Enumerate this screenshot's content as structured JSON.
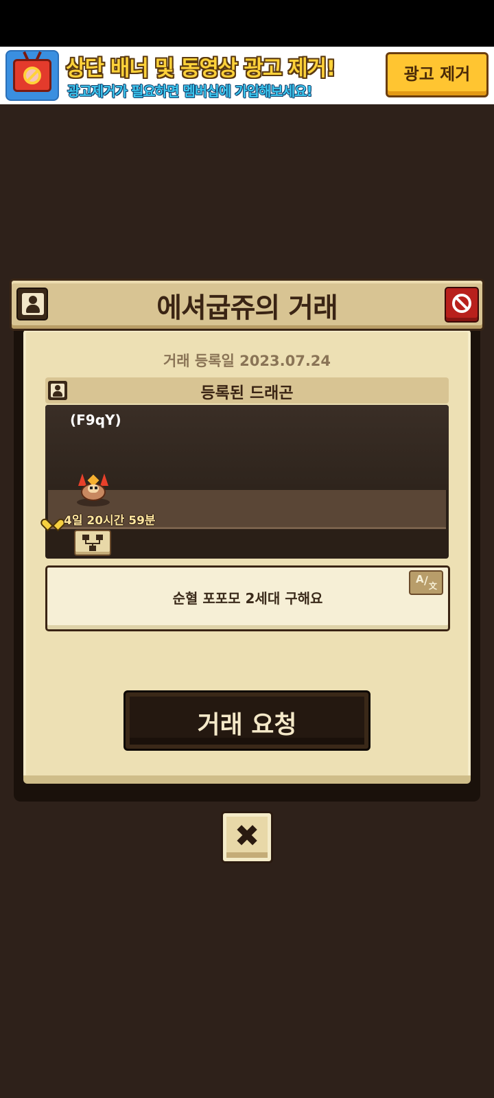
{
  "ad_banner": {
    "title": "상단 배너 및 동영상 광고 제거!",
    "subtitle": "광고제거가 필요하면 멤버십에 가입해보세요!",
    "remove_button": "광고 제거",
    "icon": "no-ads-tv-icon"
  },
  "trade_panel": {
    "title": "에셔굽쥬의 거래",
    "profile_icon": "profile-icon",
    "block_icon": "block-icon",
    "registered_date": "거래 등록일 2023.07.24",
    "section_title": "등록된 드래곤",
    "dragon": {
      "name": "(F9qY)",
      "timer": "4일 20시간 59분",
      "timer_icon": "heart-icon",
      "family_tree_icon": "family-tree-icon"
    },
    "memo": "순혈 포포모 2세대 구해요",
    "translate_icon": "translate-icon",
    "translate_label": {
      "a": "A",
      "slash": "/",
      "z": "文"
    },
    "request_button": "거래 요청"
  },
  "close_button": {
    "label": "✖",
    "icon": "close-icon"
  },
  "colors": {
    "background": "#2e211a",
    "panel": "#ede0b4",
    "header": "#d8c493",
    "accent_red": "#b8201c",
    "ad_yellow": "#ffc531"
  }
}
